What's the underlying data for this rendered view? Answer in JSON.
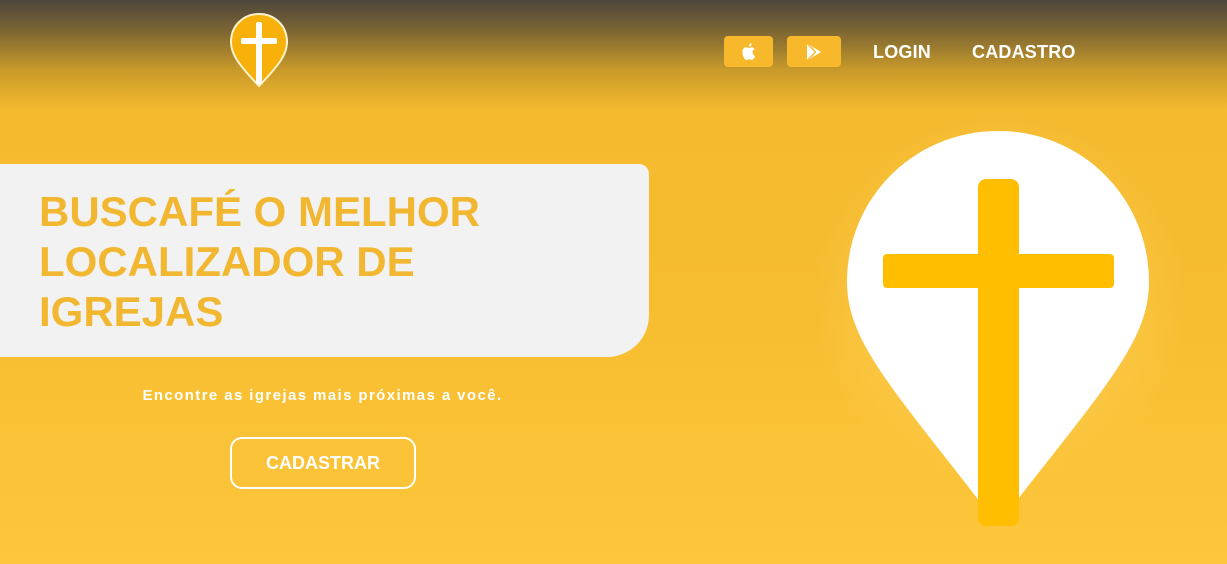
{
  "header": {
    "logo_icon": "church-pin-icon",
    "store_buttons": [
      {
        "icon": "apple-icon"
      },
      {
        "icon": "play-store-icon"
      }
    ],
    "nav": {
      "login": "LOGIN",
      "cadastro": "CADASTRO"
    }
  },
  "hero": {
    "title": "BUSCAFÉ O MELHOR LOCALIZADOR DE IGREJAS",
    "subtitle": "Encontre as igrejas mais próximas a você.",
    "cta_label": "CADASTRAR",
    "illustration_icon": "church-location-pin-icon"
  },
  "colors": {
    "accent_yellow": "#f7bd30",
    "title_yellow": "#f2b730",
    "cross_yellow": "#ffbe00",
    "hero_box": "#f2f2f2"
  }
}
